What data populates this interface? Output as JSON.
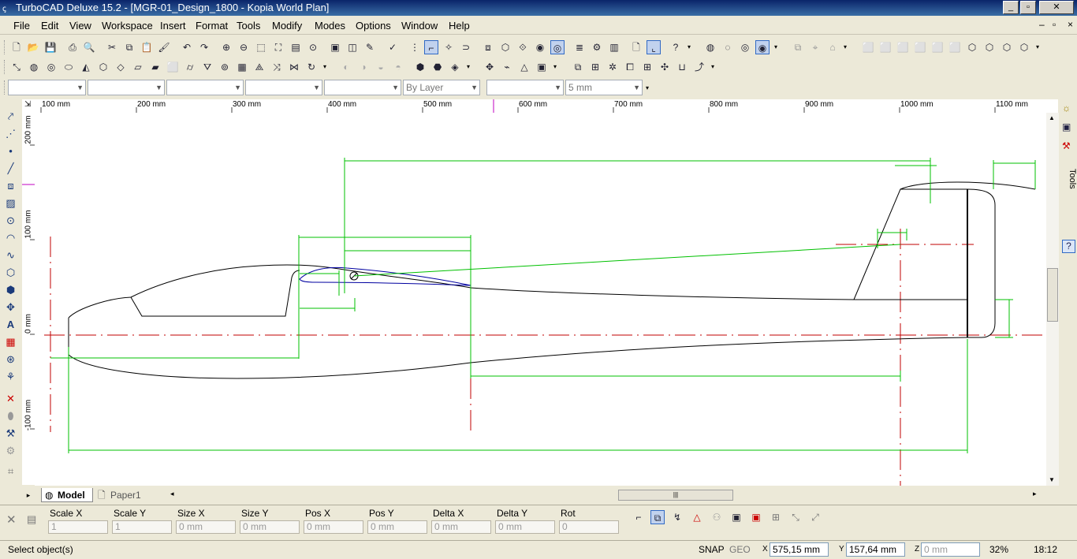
{
  "window": {
    "title": "TurboCAD Deluxe 15.2 - [MGR-01_Design_1800 - Kopia World Plan]",
    "app_icon": "turbocad-icon",
    "controls": [
      "minimize-icon",
      "restore-icon",
      "close-icon"
    ]
  },
  "menu": {
    "items": [
      "File",
      "Edit",
      "View",
      "Workspace",
      "Insert",
      "Format",
      "Tools",
      "Modify",
      "Modes",
      "Options",
      "Window",
      "Help"
    ],
    "mdi_controls": [
      "–",
      "▫",
      "×"
    ]
  },
  "property_bar": {
    "combos": [
      "",
      "",
      "",
      "",
      "",
      "By Layer",
      "",
      "5 mm"
    ]
  },
  "ruler": {
    "h_labels": [
      "100 mm",
      "200 mm",
      "300 mm",
      "400 mm",
      "500 mm",
      "600 mm",
      "700 mm",
      "800 mm",
      "900 mm",
      "1000 mm",
      "1100 mm"
    ],
    "v_labels": [
      "200 mm",
      "100 mm",
      "0 mm",
      "-100 mm"
    ]
  },
  "right_panel": {
    "label": "Tools"
  },
  "tabs": [
    {
      "label": "Model",
      "active": true
    },
    {
      "label": "Paper1",
      "active": false
    }
  ],
  "inspector": {
    "fields": [
      {
        "label": "Scale X",
        "value": "1"
      },
      {
        "label": "Scale Y",
        "value": "1"
      },
      {
        "label": "Size X",
        "value": "0 mm"
      },
      {
        "label": "Size Y",
        "value": "0 mm"
      },
      {
        "label": "Pos X",
        "value": "0 mm"
      },
      {
        "label": "Pos Y",
        "value": "0 mm"
      },
      {
        "label": "Delta X",
        "value": "0 mm"
      },
      {
        "label": "Delta Y",
        "value": "0 mm"
      },
      {
        "label": "Rot",
        "value": "0"
      }
    ]
  },
  "status": {
    "message": "Select object(s)",
    "snap": "SNAP",
    "geo": "GEO",
    "x": "575,15 mm",
    "y": "157,64 mm",
    "z": "0 mm",
    "zoom": "32%",
    "time": "18:12"
  },
  "colors": {
    "title_bar": "#0a246a",
    "drawing_line": "#000000",
    "dimension": "#00c000",
    "centerline": "#c00000",
    "airfoil": "#0000a0"
  }
}
